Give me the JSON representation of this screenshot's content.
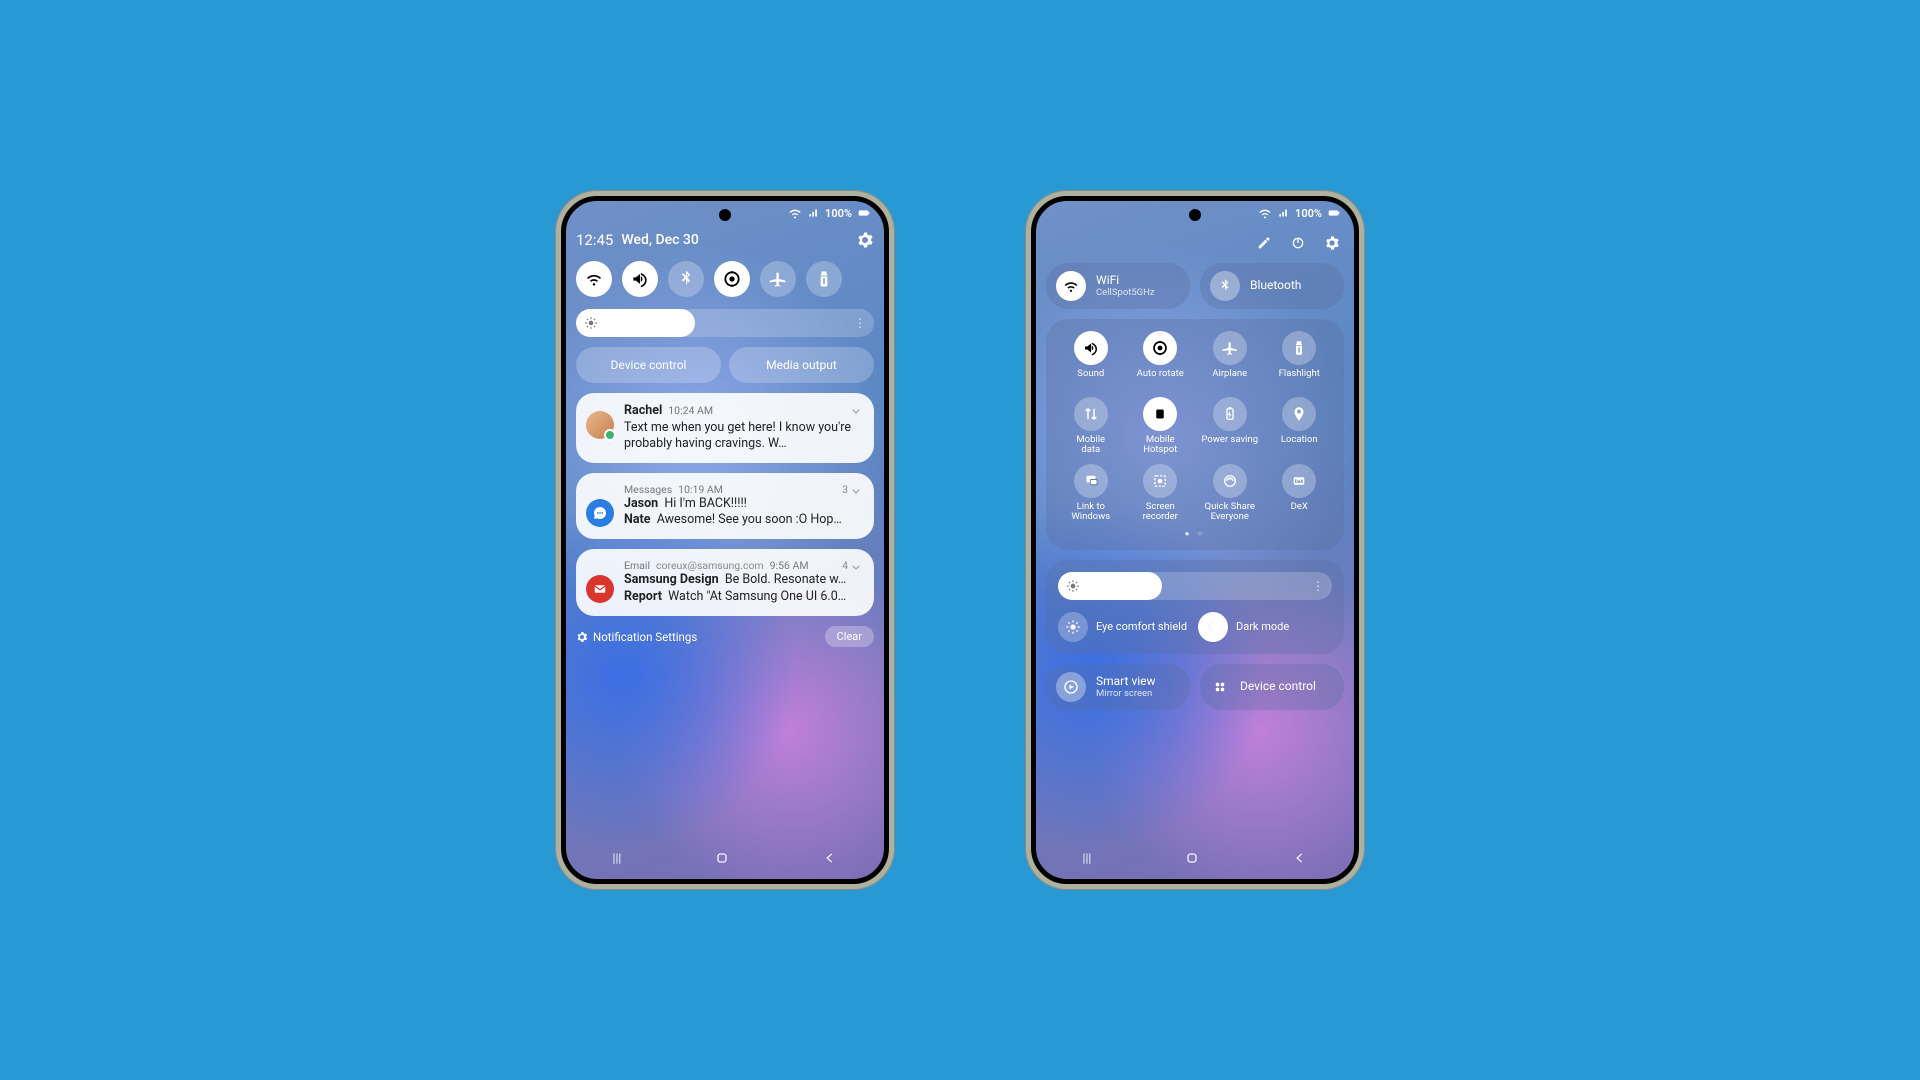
{
  "status": {
    "battery": "100%"
  },
  "left": {
    "time": "12:45",
    "date": "Wed, Dec 30",
    "toggles": [
      {
        "name": "wifi",
        "on": true
      },
      {
        "name": "sound",
        "on": true
      },
      {
        "name": "bluetooth",
        "on": false
      },
      {
        "name": "rotate",
        "on": true
      },
      {
        "name": "airplane",
        "on": false
      },
      {
        "name": "flashlight",
        "on": false
      }
    ],
    "brightness_pct": 40,
    "chips": {
      "device_control": "Device control",
      "media_output": "Media output"
    },
    "notifications": [
      {
        "name": "Rachel",
        "time": "10:24 AM",
        "text": "Text me when you get here! I know you're probably having cravings. W…"
      },
      {
        "app": "Messages",
        "time": "10:19 AM",
        "count": "3",
        "lines": [
          {
            "b": "Jason",
            "t": "Hi I'm BACK!!!!!"
          },
          {
            "b": "Nate",
            "t": "Awesome! See you soon :O Hop…"
          }
        ]
      },
      {
        "app": "Email",
        "addr": "coreux@samsung.com",
        "time": "9:56 AM",
        "count": "4",
        "lines": [
          {
            "b": "Samsung Design",
            "t": "Be Bold. Resonate w…"
          },
          {
            "b": "Report",
            "t": "Watch \"At Samsung One UI 6.0…"
          }
        ]
      }
    ],
    "footer": {
      "settings": "Notification Settings",
      "clear": "Clear"
    }
  },
  "right": {
    "pills": {
      "wifi": {
        "label": "WiFi",
        "sub": "CellSpot5GHz",
        "on": true
      },
      "bluetooth": {
        "label": "Bluetooth",
        "on": false
      }
    },
    "qs": [
      {
        "key": "sound",
        "label": "Sound",
        "on": true
      },
      {
        "key": "rotate",
        "label": "Auto rotate",
        "on": true
      },
      {
        "key": "airplane",
        "label": "Airplane",
        "on": false
      },
      {
        "key": "flash",
        "label": "Flashlight",
        "on": false
      },
      {
        "key": "data",
        "label": "Mobile\ndata",
        "on": false
      },
      {
        "key": "hotspot",
        "label": "Mobile\nHotspot",
        "on": true
      },
      {
        "key": "psave",
        "label": "Power saving",
        "on": false
      },
      {
        "key": "loc",
        "label": "Location",
        "on": false
      },
      {
        "key": "link",
        "label": "Link to\nWindows",
        "on": false
      },
      {
        "key": "rec",
        "label": "Screen\nrecorder",
        "on": false
      },
      {
        "key": "share",
        "label": "Quick Share\nEveryone",
        "on": false
      },
      {
        "key": "dex",
        "label": "DeX",
        "on": false
      }
    ],
    "brightness_pct": 38,
    "display": {
      "eye": {
        "label": "Eye comfort shield",
        "on": false
      },
      "dark": {
        "label": "Dark mode",
        "on": true
      }
    },
    "bottom": {
      "smartview": {
        "label": "Smart view",
        "sub": "Mirror screen"
      },
      "device": {
        "label": "Device control"
      }
    }
  }
}
